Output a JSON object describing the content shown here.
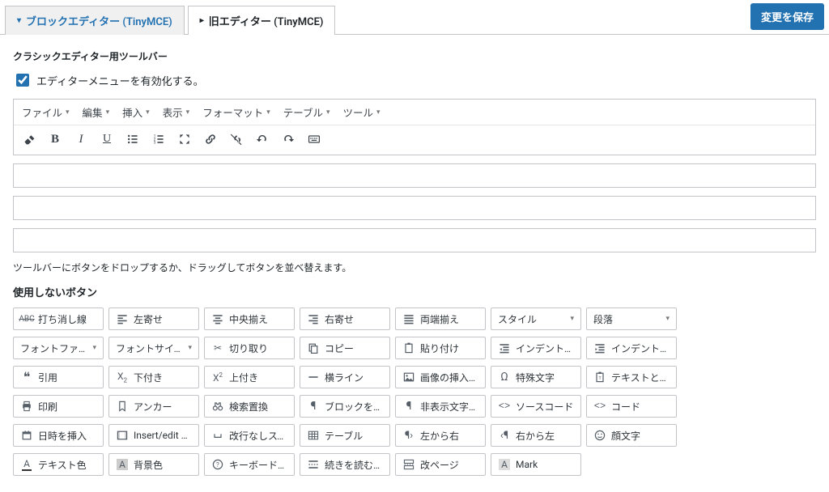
{
  "tabs": {
    "block": "ブロックエディター (TinyMCE)",
    "classic": "旧エディター (TinyMCE)"
  },
  "save_label": "変更を保存",
  "classic_toolbar_heading": "クラシックエディター用ツールバー",
  "enable_menu_label": "エディターメニューを有効化する。",
  "menubar": {
    "file": "ファイル",
    "edit": "編集",
    "insert": "挿入",
    "view": "表示",
    "format": "フォーマット",
    "table": "テーブル",
    "tool": "ツール"
  },
  "drop_hint": "ツールバーにボタンをドロップするか、ドラッグしてボタンを並べ替えます。",
  "unused_heading": "使用しないボタン",
  "buttons": {
    "strikethrough": "打ち消し線",
    "alignleft": "左寄せ",
    "aligncenter": "中央揃え",
    "alignright": "右寄せ",
    "justify": "両端揃え",
    "style": "スタイル",
    "paragraph": "段落",
    "fontfamily": "フォントファミリー",
    "fontsize": "フォントサイズ",
    "cut": "切り取り",
    "copy": "コピー",
    "paste": "貼り付け",
    "outdent": "インデントを減らす",
    "indent": "インデントを増やす",
    "blockquote": "引用",
    "subscript": "下付き",
    "superscript": "上付き",
    "hr": "横ライン",
    "image": "画像の挿入/編集",
    "charmap": "特殊文字",
    "pastetext": "テキストとしてペー…",
    "print": "印刷",
    "anchor": "アンカー",
    "searchreplace": "検索置換",
    "showblocks": "ブロックを表示",
    "invisibles": "非表示文字を表示",
    "sourcecode": "ソースコード",
    "code": "コード",
    "datetime": "日時を挿入",
    "insertvideo": "Insert/edit video",
    "nbsp": "改行なしスペース",
    "table": "テーブル",
    "ltr": "左から右",
    "rtl": "右から左",
    "emoji": "顔文字",
    "textcolor": "テキスト色",
    "backcolor": "背景色",
    "kbshortcut": "キーボードショー…",
    "readmore": "続きを読む…",
    "pagebreak": "改ページ",
    "mark": "Mark"
  }
}
